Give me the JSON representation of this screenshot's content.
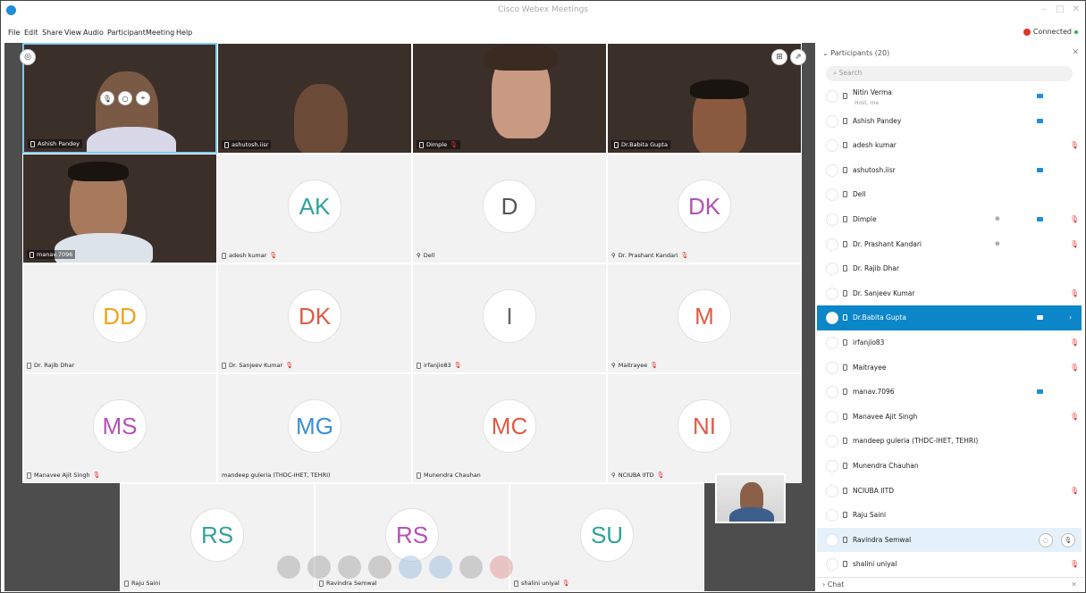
{
  "window": {
    "title": "Cisco Webex Meetings",
    "connection": "Connected"
  },
  "menu": [
    "File",
    "Edit",
    "Share",
    "View",
    "Audio",
    "Participant",
    "Meeting",
    "Help"
  ],
  "video_tiles": [
    {
      "name": "Ashish Pandey"
    },
    {
      "name": "ashutosh.iisr"
    },
    {
      "name": "Dimple"
    },
    {
      "name": "Dr.Babita Gupta"
    },
    {
      "name": "manav.7096"
    }
  ],
  "avatar_tiles": [
    {
      "initials": "AK",
      "name": "adesh kumar",
      "color": "#2fa39a",
      "muted": true
    },
    {
      "initials": "D",
      "name": "Dell",
      "color": "#555555",
      "muted": false
    },
    {
      "initials": "DK",
      "name": "Dr. Prashant Kandari",
      "color": "#b451b5",
      "muted": true
    },
    {
      "initials": "DD",
      "name": "Dr. Rajib Dhar",
      "color": "#f2a21f",
      "muted": false
    },
    {
      "initials": "DK",
      "name": "Dr. Sanjeev Kumar",
      "color": "#e05a43",
      "muted": true
    },
    {
      "initials": "I",
      "name": "irfanjio83",
      "color": "#666666",
      "muted": true
    },
    {
      "initials": "M",
      "name": "Maitrayee",
      "color": "#e05a43",
      "muted": true
    },
    {
      "initials": "MS",
      "name": "Manavee Ajit Singh",
      "color": "#b451b5",
      "muted": true
    },
    {
      "initials": "MG",
      "name": "mandeep guleria (THDC-IHET, TEHRI)",
      "color": "#3a8fd4",
      "muted": false
    },
    {
      "initials": "MC",
      "name": "Munendra Chauhan",
      "color": "#e05a43",
      "muted": false
    },
    {
      "initials": "NI",
      "name": "NCIUBA IITD",
      "color": "#e05a43",
      "muted": true
    },
    {
      "initials": "RS",
      "name": "Raju Saini",
      "color": "#2fa39a",
      "muted": false
    },
    {
      "initials": "RS",
      "name": "Ravindra Semwal",
      "color": "#b451b5",
      "muted": false
    },
    {
      "initials": "SU",
      "name": "shalini uniyal",
      "color": "#2fa39a",
      "muted": true
    }
  ],
  "panel": {
    "header": "Participants (20)",
    "search_placeholder": "Search",
    "chat_label": "Chat",
    "participants": [
      {
        "name": "Nitin Verma",
        "sub": "Host, me",
        "cam": true,
        "mic_off": false
      },
      {
        "name": "Ashish Pandey",
        "cam": true,
        "mic_off": false
      },
      {
        "name": "adesh kumar",
        "cam": false,
        "mic_off": true
      },
      {
        "name": "ashutosh.iisr",
        "cam": true,
        "mic_off": false
      },
      {
        "name": "Dell",
        "cam": false,
        "mic_off": false
      },
      {
        "name": "Dimple",
        "cam": true,
        "mic_off": true,
        "share": true
      },
      {
        "name": "Dr. Prashant Kandari",
        "cam": false,
        "mic_off": true,
        "share": true
      },
      {
        "name": "Dr. Rajib Dhar",
        "cam": false,
        "mic_off": false
      },
      {
        "name": "Dr. Sanjeev Kumar",
        "cam": false,
        "mic_off": true
      },
      {
        "name": "Dr.Babita Gupta",
        "cam": true,
        "mic_off": false,
        "selected": true
      },
      {
        "name": "irfanjio83",
        "cam": false,
        "mic_off": true
      },
      {
        "name": "Maitrayee",
        "cam": false,
        "mic_off": true
      },
      {
        "name": "manav.7096",
        "cam": true,
        "mic_off": false
      },
      {
        "name": "Manavee Ajit Singh",
        "cam": false,
        "mic_off": true
      },
      {
        "name": "mandeep guleria (THDC-IHET, TEHRI)",
        "cam": false,
        "mic_off": false
      },
      {
        "name": "Munendra Chauhan",
        "cam": false,
        "mic_off": false
      },
      {
        "name": "NCIUBA IITD",
        "cam": false,
        "mic_off": true
      },
      {
        "name": "Raju Saini",
        "cam": false,
        "mic_off": false
      },
      {
        "name": "Ravindra Semwal",
        "cam": false,
        "mic_off": false,
        "hover": true
      },
      {
        "name": "shalini uniyal",
        "cam": false,
        "mic_off": true
      }
    ]
  }
}
